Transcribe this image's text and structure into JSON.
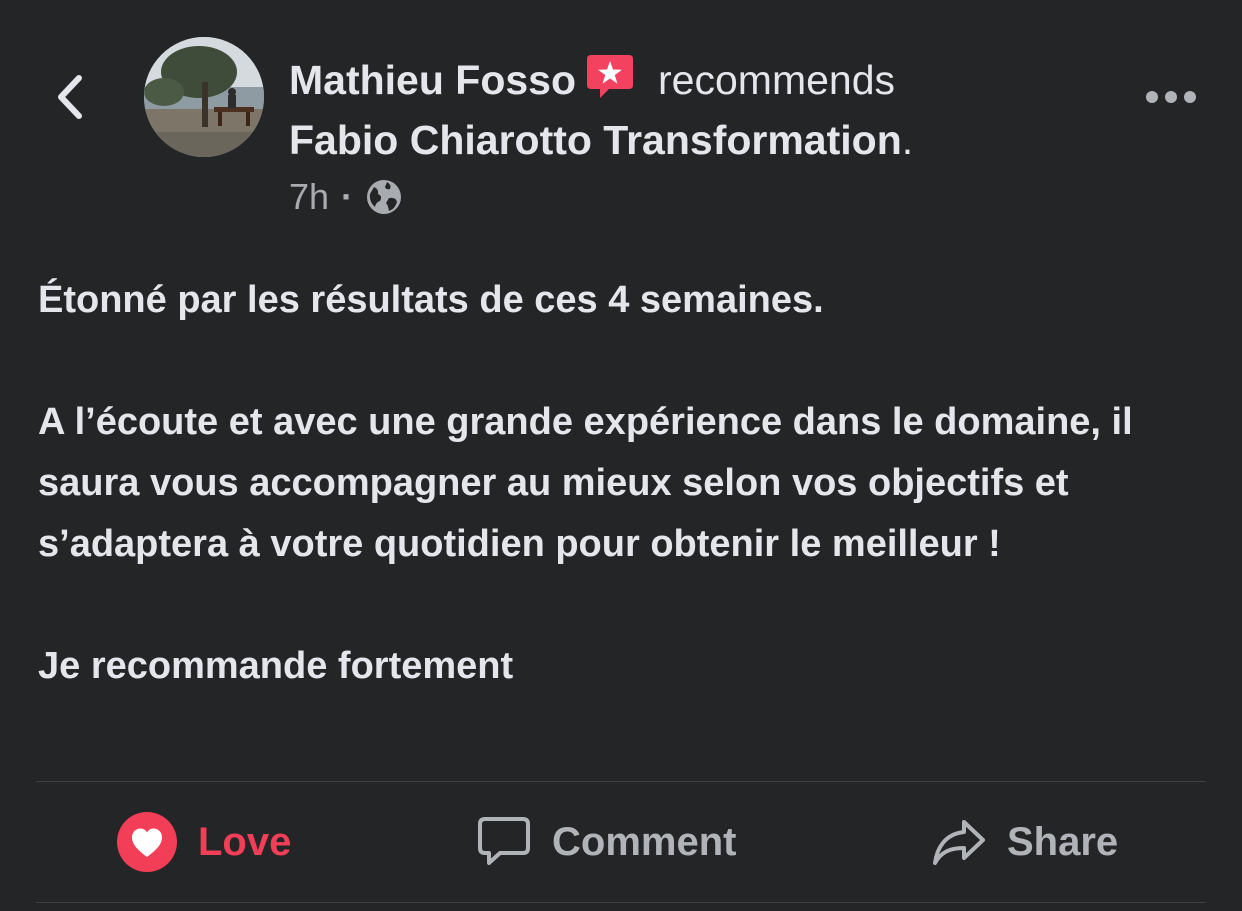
{
  "header": {
    "author": "Mathieu Fosso",
    "badge_icon": "recommendation-star-icon",
    "verb": "recommends",
    "page_name": "Fabio Chiarotto Transformation",
    "period": ".",
    "timestamp": "7h",
    "separator": "·",
    "privacy_icon": "globe-icon"
  },
  "post": {
    "line1": "Étonné par les résultats de ces 4 semaines.",
    "paragraph2": "A l’écoute et avec une grande expérience dans le domaine, il saura vous accompagner au mieux selon vos objectifs et s’adaptera à votre quotidien pour obtenir le meilleur !",
    "line3": "Je recommande fortement"
  },
  "actions": {
    "love_label": "Love",
    "comment_label": "Comment",
    "share_label": "Share"
  },
  "colors": {
    "background": "#242526",
    "text": "#e4e6eb",
    "muted": "#b0b3b8",
    "love": "#f33e58",
    "badge": "#f3425f"
  }
}
